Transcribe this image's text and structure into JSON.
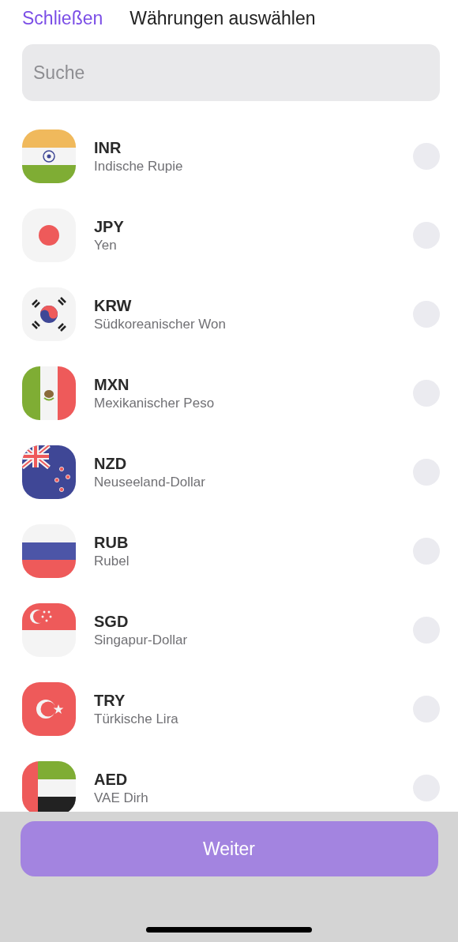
{
  "header": {
    "close": "Schließen",
    "title": "Währungen auswählen"
  },
  "search": {
    "placeholder": "Suche"
  },
  "currencies": [
    {
      "code": "INR",
      "name": "Indische Rupie",
      "kind": "india",
      "selected": false
    },
    {
      "code": "JPY",
      "name": "Yen",
      "kind": "japan",
      "selected": false
    },
    {
      "code": "KRW",
      "name": "Südkoreanischer Won",
      "kind": "korea",
      "selected": false
    },
    {
      "code": "MXN",
      "name": "Mexikanischer Peso",
      "kind": "mexico",
      "selected": false
    },
    {
      "code": "NZD",
      "name": "Neuseeland-Dollar",
      "kind": "newzealand",
      "selected": false
    },
    {
      "code": "RUB",
      "name": "Rubel",
      "kind": "russia",
      "selected": false
    },
    {
      "code": "SGD",
      "name": "Singapur-Dollar",
      "kind": "singapore",
      "selected": false
    },
    {
      "code": "TRY",
      "name": "Türkische Lira",
      "kind": "turkey",
      "selected": false
    },
    {
      "code": "AED",
      "name": "VAE Dirh",
      "kind": "uae",
      "selected": false
    }
  ],
  "footer": {
    "button": "Weiter"
  }
}
